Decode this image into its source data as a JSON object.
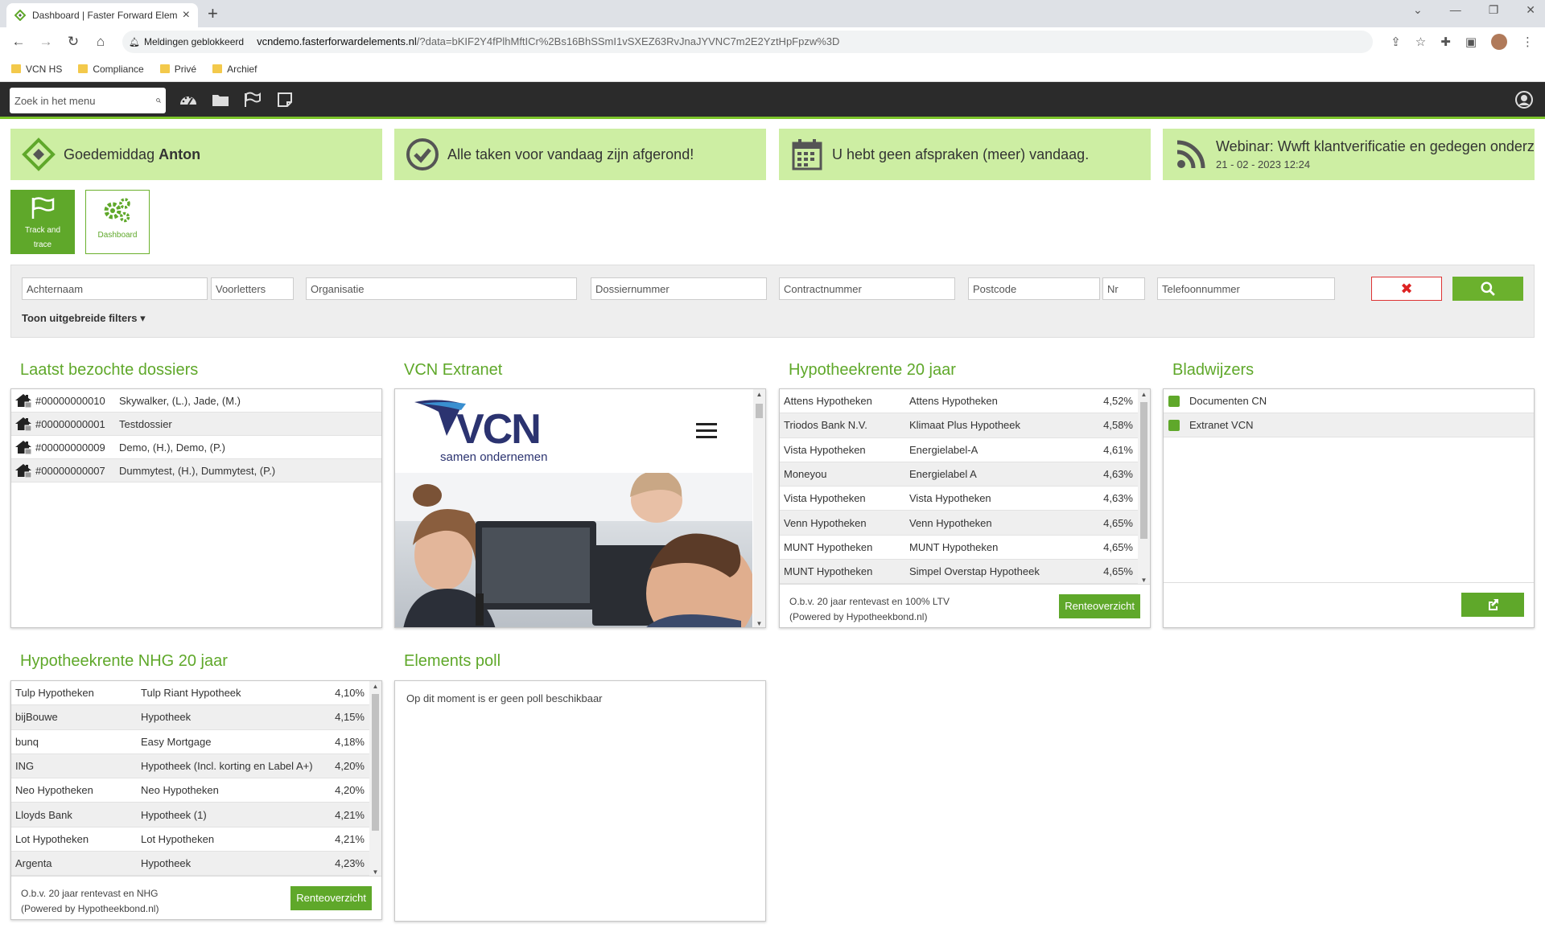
{
  "browser": {
    "tab_title": "Dashboard | Faster Forward Elem",
    "notification": "Meldingen geblokkeerd",
    "url_host": "vcndemo.fasterforwardelements.nl",
    "url_rest": "/?data=bKIF2Y4fPlhMftICr%2Bs16BhSSmI1vSXEZ63RvJnaJYVNC7m2E2YztHpFpzw%3D",
    "bookmarks": [
      "VCN HS",
      "Compliance",
      "Privé",
      "Archief"
    ]
  },
  "header": {
    "menu_search_placeholder": "Zoek in het menu"
  },
  "tiles": {
    "greeting_prefix": "Goedemiddag",
    "greeting_name": "Anton",
    "tasks": "Alle taken voor vandaag zijn afgerond!",
    "appointments": "U hebt geen afspraken (meer) vandaag.",
    "webinar_title": "Webinar: Wwft klantverificatie en gedegen onderz",
    "webinar_date": "21 - 02 - 2023 12:24"
  },
  "quick": {
    "track_label_1": "Track and",
    "track_label_2": "trace",
    "dashboard_label": "Dashboard"
  },
  "search": {
    "achternaam": "Achternaam",
    "voorletters": "Voorletters",
    "organisatie": "Organisatie",
    "dossiernummer": "Dossiernummer",
    "contractnummer": "Contractnummer",
    "postcode": "Postcode",
    "nr": "Nr",
    "telefoonnummer": "Telefoonnummer",
    "filters_label": "Toon uitgebreide filters"
  },
  "recent": {
    "title": "Laatst bezochte dossiers",
    "rows": [
      {
        "num": "#00000000010",
        "name": "Skywalker, (L.), Jade, (M.)"
      },
      {
        "num": "#00000000001",
        "name": "Testdossier"
      },
      {
        "num": "#00000000009",
        "name": "Demo, (H.), Demo, (P.)"
      },
      {
        "num": "#00000000007",
        "name": "Dummytest, (H.), Dummytest, (P.)"
      }
    ]
  },
  "extranet": {
    "title": "VCN Extranet",
    "logo_text": "VCN",
    "tagline": "samen ondernemen"
  },
  "rente20": {
    "title": "Hypotheekrente 20 jaar",
    "rows": [
      {
        "bank": "Attens Hypotheken",
        "product": "Attens Hypotheken",
        "rate": "4,52%"
      },
      {
        "bank": "Triodos Bank N.V.",
        "product": "Klimaat Plus Hypotheek",
        "rate": "4,58%"
      },
      {
        "bank": "Vista Hypotheken",
        "product": "Energielabel-A",
        "rate": "4,61%"
      },
      {
        "bank": "Moneyou",
        "product": "Energielabel A",
        "rate": "4,63%"
      },
      {
        "bank": "Vista Hypotheken",
        "product": "Vista Hypotheken",
        "rate": "4,63%"
      },
      {
        "bank": "Venn Hypotheken",
        "product": "Venn Hypotheken",
        "rate": "4,65%"
      },
      {
        "bank": "MUNT Hypotheken",
        "product": "MUNT Hypotheken",
        "rate": "4,65%"
      },
      {
        "bank": "MUNT Hypotheken",
        "product": "Simpel Overstap Hypotheek",
        "rate": "4,65%"
      }
    ],
    "footer_1": "O.b.v. 20 jaar rentevast en 100% LTV",
    "footer_2": "(Powered by Hypotheekbond.nl)",
    "button": "Renteoverzicht"
  },
  "bladwijzers": {
    "title": "Bladwijzers",
    "rows": [
      "Documenten CN",
      "Extranet VCN"
    ]
  },
  "nhg": {
    "title": "Hypotheekrente NHG 20 jaar",
    "rows": [
      {
        "bank": "Tulp Hypotheken",
        "product": "Tulp Riant Hypotheek",
        "rate": "4,10%"
      },
      {
        "bank": "bijBouwe",
        "product": "Hypotheek",
        "rate": "4,15%"
      },
      {
        "bank": "bunq",
        "product": "Easy Mortgage",
        "rate": "4,18%"
      },
      {
        "bank": "ING",
        "product": "Hypotheek (Incl. korting en Label A+)",
        "rate": "4,20%"
      },
      {
        "bank": "Neo Hypotheken",
        "product": "Neo Hypotheken",
        "rate": "4,20%"
      },
      {
        "bank": "Lloyds Bank",
        "product": "Hypotheek (1)",
        "rate": "4,21%"
      },
      {
        "bank": "Lot Hypotheken",
        "product": "Lot Hypotheken",
        "rate": "4,21%"
      },
      {
        "bank": "Argenta",
        "product": "Hypotheek",
        "rate": "4,23%"
      }
    ],
    "footer_1": "O.b.v. 20 jaar rentevast en NHG",
    "footer_2": "(Powered by Hypotheekbond.nl)",
    "button": "Renteoverzicht"
  },
  "poll": {
    "title": "Elements poll",
    "message": "Op dit moment is er geen poll beschikbaar"
  },
  "colors": {
    "accent": "#5fa82a",
    "tile_bg": "#cdeea3",
    "header_bg": "#2b2b2b"
  }
}
